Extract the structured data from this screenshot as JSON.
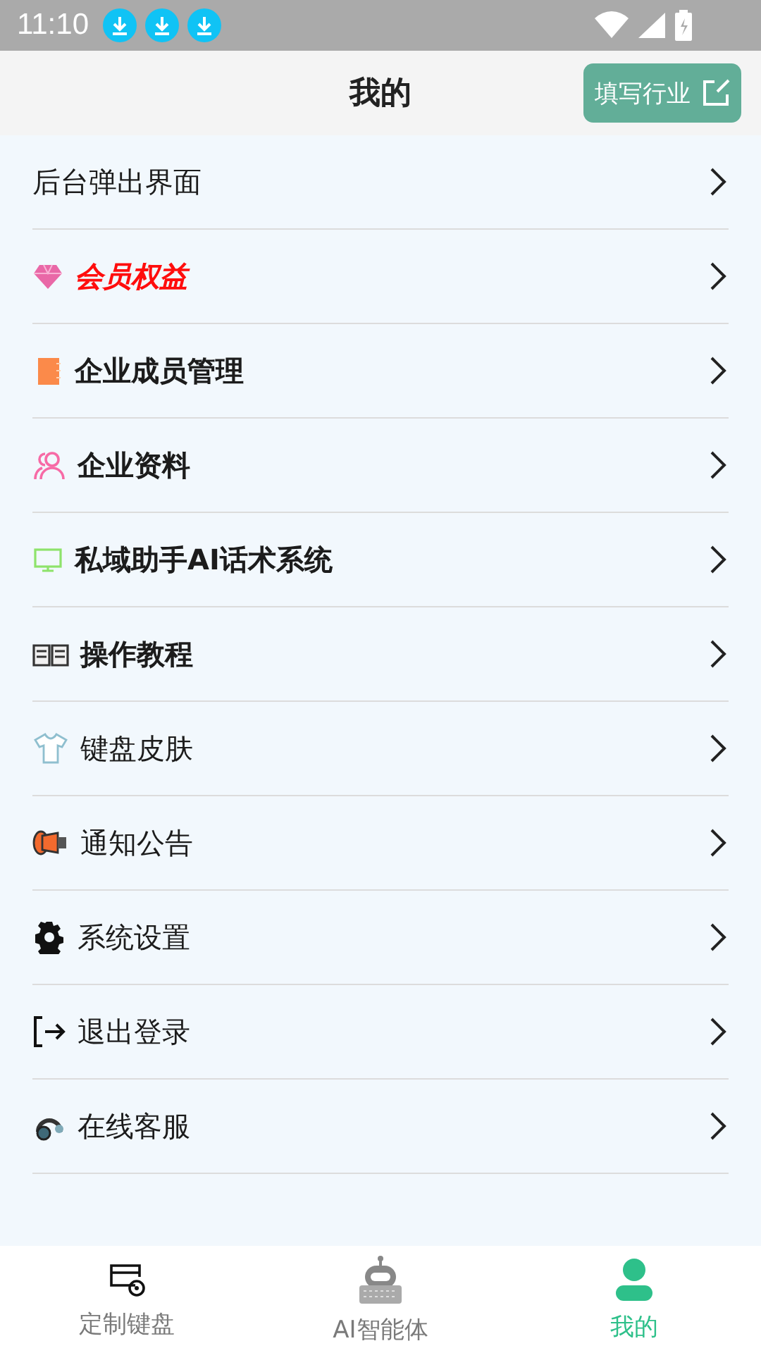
{
  "status_bar": {
    "time": "11:10"
  },
  "header": {
    "title": "我的",
    "action": "填写行业"
  },
  "menu": [
    {
      "label": "后台弹出界面",
      "kind": "plain"
    },
    {
      "label": "会员权益",
      "kind": "diamond"
    },
    {
      "label": "企业成员管理",
      "kind": "notebook"
    },
    {
      "label": "企业资料",
      "kind": "people"
    },
    {
      "label": "私域助手AI话术系统",
      "kind": "monitor"
    },
    {
      "label": "操作教程",
      "kind": "book"
    },
    {
      "label": "键盘皮肤",
      "kind": "shirt"
    },
    {
      "label": "通知公告",
      "kind": "megaphone"
    },
    {
      "label": "系统设置",
      "kind": "gear"
    },
    {
      "label": "退出登录",
      "kind": "logout"
    },
    {
      "label": "在线客服",
      "kind": "headset"
    }
  ],
  "tabs": [
    {
      "label": "定制键盘",
      "kind": "card",
      "selected": false
    },
    {
      "label": "AI智能体",
      "kind": "robot",
      "selected": false
    },
    {
      "label": "我的",
      "kind": "person",
      "selected": true
    }
  ]
}
